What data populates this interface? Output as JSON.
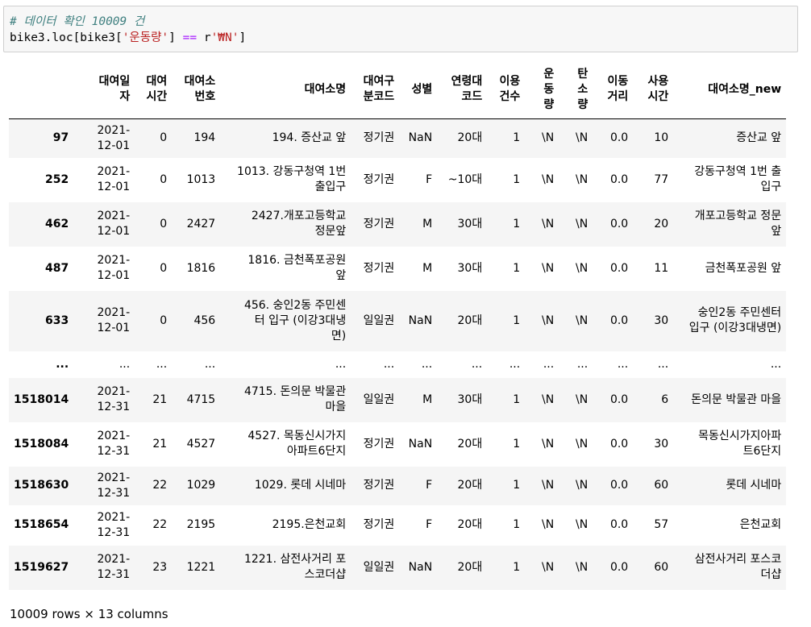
{
  "code": {
    "line1": "# 데이터 확인 10009 건",
    "line2_obj": "bike3.loc[bike3[",
    "line2_str1": "'운동량'",
    "line2_mid": "] ",
    "line2_op": "==",
    "line2_sp": " r",
    "line2_str2": "'₩N'",
    "line2_end": "]"
  },
  "table": {
    "columns": [
      "대여일자",
      "대여시간",
      "대여소번호",
      "대여소명",
      "대여구분코드",
      "성별",
      "연령대코드",
      "이용건수",
      "운동량",
      "탄소량",
      "이동거리",
      "사용시간",
      "대여소명_new"
    ],
    "header_lines": [
      [
        "대여일",
        "자"
      ],
      [
        "대여",
        "시간"
      ],
      [
        "대여소",
        "번호"
      ],
      [
        "대여소명"
      ],
      [
        "대여구",
        "분코드"
      ],
      [
        "성별"
      ],
      [
        "연령대",
        "코드"
      ],
      [
        "이용",
        "건수"
      ],
      [
        "운",
        "동",
        "량"
      ],
      [
        "탄",
        "소",
        "량"
      ],
      [
        "이동",
        "거리"
      ],
      [
        "사용",
        "시간"
      ],
      [
        "대여소명_new"
      ]
    ],
    "rows": [
      {
        "index": "97",
        "cells": [
          [
            "2021-",
            "12-01"
          ],
          [
            "0"
          ],
          [
            "194"
          ],
          [
            "194. 증산교 앞"
          ],
          [
            "정기권"
          ],
          [
            "NaN"
          ],
          [
            "20대"
          ],
          [
            "1"
          ],
          [
            "\\N"
          ],
          [
            "\\N"
          ],
          [
            "0.0"
          ],
          [
            "10"
          ],
          [
            "증산교 앞"
          ]
        ]
      },
      {
        "index": "252",
        "cells": [
          [
            "2021-",
            "12-01"
          ],
          [
            "0"
          ],
          [
            "1013"
          ],
          [
            "1013. 강동구청역 1번",
            "출입구"
          ],
          [
            "정기권"
          ],
          [
            "F"
          ],
          [
            "~10대"
          ],
          [
            "1"
          ],
          [
            "\\N"
          ],
          [
            "\\N"
          ],
          [
            "0.0"
          ],
          [
            "77"
          ],
          [
            "강동구청역 1번 출",
            "입구"
          ]
        ]
      },
      {
        "index": "462",
        "cells": [
          [
            "2021-",
            "12-01"
          ],
          [
            "0"
          ],
          [
            "2427"
          ],
          [
            "2427.개포고등학교",
            "정문앞"
          ],
          [
            "정기권"
          ],
          [
            "M"
          ],
          [
            "30대"
          ],
          [
            "1"
          ],
          [
            "\\N"
          ],
          [
            "\\N"
          ],
          [
            "0.0"
          ],
          [
            "20"
          ],
          [
            "개포고등학교 정문",
            "앞"
          ]
        ]
      },
      {
        "index": "487",
        "cells": [
          [
            "2021-",
            "12-01"
          ],
          [
            "0"
          ],
          [
            "1816"
          ],
          [
            "1816. 금천폭포공원",
            "앞"
          ],
          [
            "정기권"
          ],
          [
            "M"
          ],
          [
            "30대"
          ],
          [
            "1"
          ],
          [
            "\\N"
          ],
          [
            "\\N"
          ],
          [
            "0.0"
          ],
          [
            "11"
          ],
          [
            "금천폭포공원 앞"
          ]
        ]
      },
      {
        "index": "633",
        "cells": [
          [
            "2021-",
            "12-01"
          ],
          [
            "0"
          ],
          [
            "456"
          ],
          [
            "456. 숭인2동 주민센",
            "터 입구 (이강3대냉",
            "면)"
          ],
          [
            "일일권"
          ],
          [
            "NaN"
          ],
          [
            "20대"
          ],
          [
            "1"
          ],
          [
            "\\N"
          ],
          [
            "\\N"
          ],
          [
            "0.0"
          ],
          [
            "30"
          ],
          [
            "숭인2동 주민센터",
            "입구 (이강3대냉면)"
          ]
        ]
      },
      {
        "index": "...",
        "cells": [
          [
            "..."
          ],
          [
            "..."
          ],
          [
            "..."
          ],
          [
            "..."
          ],
          [
            "..."
          ],
          [
            "..."
          ],
          [
            "..."
          ],
          [
            "..."
          ],
          [
            "..."
          ],
          [
            "..."
          ],
          [
            "..."
          ],
          [
            "..."
          ],
          [
            "..."
          ]
        ]
      },
      {
        "index": "1518014",
        "cells": [
          [
            "2021-",
            "12-31"
          ],
          [
            "21"
          ],
          [
            "4715"
          ],
          [
            "4715. 돈의문 박물관",
            "마을"
          ],
          [
            "일일권"
          ],
          [
            "M"
          ],
          [
            "30대"
          ],
          [
            "1"
          ],
          [
            "\\N"
          ],
          [
            "\\N"
          ],
          [
            "0.0"
          ],
          [
            "6"
          ],
          [
            "돈의문 박물관 마을"
          ]
        ]
      },
      {
        "index": "1518084",
        "cells": [
          [
            "2021-",
            "12-31"
          ],
          [
            "21"
          ],
          [
            "4527"
          ],
          [
            "4527. 목동신시가지",
            "아파트6단지"
          ],
          [
            "정기권"
          ],
          [
            "NaN"
          ],
          [
            "20대"
          ],
          [
            "1"
          ],
          [
            "\\N"
          ],
          [
            "\\N"
          ],
          [
            "0.0"
          ],
          [
            "30"
          ],
          [
            "목동신시가지아파",
            "트6단지"
          ]
        ]
      },
      {
        "index": "1518630",
        "cells": [
          [
            "2021-",
            "12-31"
          ],
          [
            "22"
          ],
          [
            "1029"
          ],
          [
            "1029. 롯데 시네마"
          ],
          [
            "정기권"
          ],
          [
            "F"
          ],
          [
            "20대"
          ],
          [
            "1"
          ],
          [
            "\\N"
          ],
          [
            "\\N"
          ],
          [
            "0.0"
          ],
          [
            "60"
          ],
          [
            "롯데 시네마"
          ]
        ]
      },
      {
        "index": "1518654",
        "cells": [
          [
            "2021-",
            "12-31"
          ],
          [
            "22"
          ],
          [
            "2195"
          ],
          [
            "2195.은천교회"
          ],
          [
            "정기권"
          ],
          [
            "F"
          ],
          [
            "20대"
          ],
          [
            "1"
          ],
          [
            "\\N"
          ],
          [
            "\\N"
          ],
          [
            "0.0"
          ],
          [
            "57"
          ],
          [
            "은천교회"
          ]
        ]
      },
      {
        "index": "1519627",
        "cells": [
          [
            "2021-",
            "12-31"
          ],
          [
            "23"
          ],
          [
            "1221"
          ],
          [
            "1221. 삼전사거리 포",
            "스코더샵"
          ],
          [
            "일일권"
          ],
          [
            "NaN"
          ],
          [
            "20대"
          ],
          [
            "1"
          ],
          [
            "\\N"
          ],
          [
            "\\N"
          ],
          [
            "0.0"
          ],
          [
            "60"
          ],
          [
            "삼전사거리 포스코",
            "더샵"
          ]
        ]
      }
    ]
  },
  "summary": "10009 rows × 13 columns"
}
